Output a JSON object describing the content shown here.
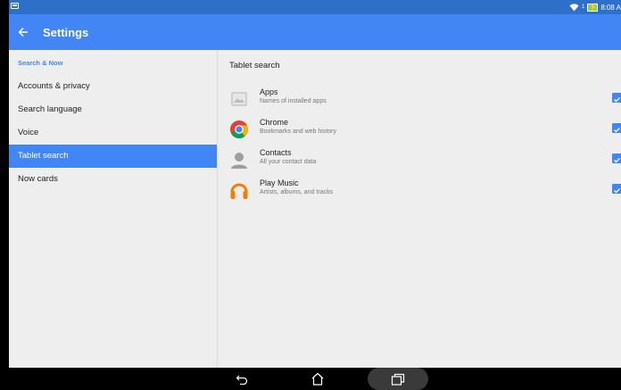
{
  "status_bar": {
    "time": "8:08 A",
    "sim_indicator": "1",
    "icons": [
      "notification-icon",
      "wifi-icon",
      "battery-charging-icon"
    ]
  },
  "app_bar": {
    "title": "Settings",
    "back_icon": "arrow-left-icon"
  },
  "sidebar": {
    "section_header": "Search & Now",
    "items": [
      {
        "label": "Accounts & privacy",
        "active": false
      },
      {
        "label": "Search language",
        "active": false
      },
      {
        "label": "Voice",
        "active": false
      },
      {
        "label": "Tablet search",
        "active": true
      },
      {
        "label": "Now cards",
        "active": false
      }
    ]
  },
  "main": {
    "title": "Tablet search",
    "options": [
      {
        "name": "Apps",
        "description": "Names of installed apps",
        "icon": "apps-icon",
        "checked": true
      },
      {
        "name": "Chrome",
        "description": "Bookmarks and web history",
        "icon": "chrome-icon",
        "checked": true
      },
      {
        "name": "Contacts",
        "description": "All your contact data",
        "icon": "contacts-icon",
        "checked": true
      },
      {
        "name": "Play Music",
        "description": "Artists, albums, and tracks",
        "icon": "play-music-icon",
        "checked": true
      }
    ]
  },
  "nav_bar": {
    "buttons": [
      "back-icon",
      "home-icon",
      "recents-icon"
    ]
  },
  "colors": {
    "status_bar": "#2e6fc9",
    "accent": "#4285f4",
    "background": "#eeeeee"
  }
}
